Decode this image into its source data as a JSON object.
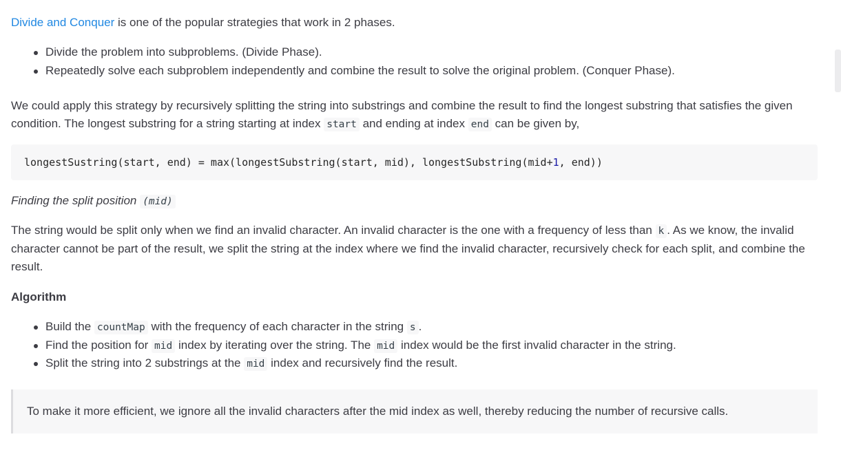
{
  "intro": {
    "link": "Divide and Conquer",
    "rest": " is one of the popular strategies that work in 2 phases."
  },
  "phases": [
    "Divide the problem into subproblems. (Divide Phase).",
    "Repeatedly solve each subproblem independently and combine the result to solve the original problem. (Conquer Phase)."
  ],
  "apply": {
    "text1": "We could apply this strategy by recursively splitting the string into substrings and combine the result to find the longest substring that satisfies the given condition. The longest substring for a string starting at index ",
    "code1": "start",
    "text2": " and ending at index ",
    "code2": "end",
    "text3": " can be given by,"
  },
  "codeblock": {
    "before": "longestSustring(start, end) = max(longestSubstring(start, mid), longestSubstring(mid+",
    "num": "1",
    "after": ", end))"
  },
  "split_heading": {
    "text": "Finding the split position ",
    "code": "(mid)"
  },
  "split_para": {
    "text1": "The string would be split only when we find an invalid character. An invalid character is the one with a frequency of less than ",
    "code": "k",
    "text2": ". As we know, the invalid character cannot be part of the result, we split the string at the index where we find the invalid character, recursively check for each split, and combine the result."
  },
  "algorithm_heading": "Algorithm",
  "steps": [
    {
      "t1": "Build the ",
      "c1": "countMap",
      "t2": " with the frequency of each character in the string ",
      "c2": "s",
      "t3": "."
    },
    {
      "t1": "Find the position for ",
      "c1": "mid",
      "t2": " index by iterating over the string. The ",
      "c2": "mid",
      "t3": " index would be the first invalid character in the string."
    },
    {
      "t1": "Split the string into 2 substrings at the ",
      "c1": "mid",
      "t2": " index and recursively find the result.",
      "c2": "",
      "t3": ""
    }
  ],
  "note": "To make it more efficient, we ignore all the invalid characters after the mid index as well, thereby reducing the number of recursive calls."
}
